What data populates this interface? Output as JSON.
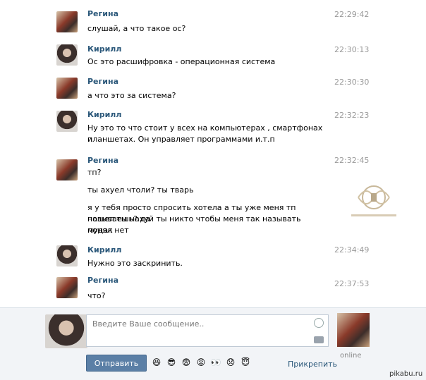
{
  "messages": [
    {
      "sender": "Регина",
      "time": "22:29:42",
      "lines": [
        "слушай, а что такое ос?"
      ],
      "avatar": "regina"
    },
    {
      "sender": "Кирилл",
      "time": "22:30:13",
      "lines": [
        "Ос это расшифровка - операционная система"
      ],
      "avatar": "kirill"
    },
    {
      "sender": "Регина",
      "time": "22:30:30",
      "lines": [
        "а что это за система?"
      ],
      "avatar": "regina"
    },
    {
      "sender": "Кирилл",
      "time": "22:32:23",
      "lines": [
        "Ну это то что стоит у всех на компьютерах , смартфонах и",
        "планшетах. Он управляет программами и.т.п"
      ],
      "avatar": "kirill"
    },
    {
      "sender": "Регина",
      "time": "22:32:45",
      "lines": [
        "тп?",
        "ты ахуел чтоли? ты тварь",
        "я у тебя просто спросить хотела а ты уже меня тп называешь? да",
        "пошел ты нахуй ты никто чтобы меня так называть понял нет",
        "мудак"
      ],
      "avatar": "regina"
    },
    {
      "sender": "Кирилл",
      "time": "22:34:49",
      "lines": [
        "Нужно это заскринить."
      ],
      "avatar": "kirill"
    },
    {
      "sender": "Регина",
      "time": "22:37:53",
      "lines": [
        "что?"
      ],
      "avatar": "regina"
    }
  ],
  "composer": {
    "placeholder": "Введите Ваше сообщение..",
    "send_label": "Отправить",
    "attach_label": "Прикрепить",
    "emojis": [
      "😆",
      "😎",
      "😨",
      "😡",
      "👀",
      "😞",
      "😇"
    ]
  },
  "peer": {
    "status": "online"
  },
  "footer": {
    "site": "pikabu.ru"
  },
  "colors": {
    "name": "#2b587a",
    "time": "#999999",
    "send_bg": "#5b7fa6",
    "composer_bg": "#f2f4f7"
  }
}
